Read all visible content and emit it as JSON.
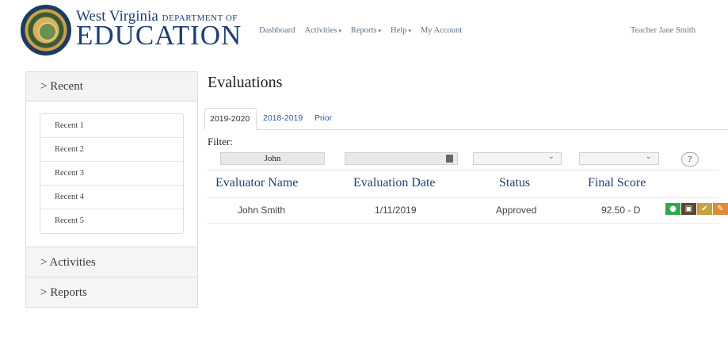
{
  "header": {
    "brand_top": "West Virginia",
    "brand_dept": "DEPARTMENT OF",
    "brand_main": "EDUCATION",
    "nav": [
      {
        "label": "Dashboard",
        "caret": false
      },
      {
        "label": "Activities",
        "caret": true
      },
      {
        "label": "Reports",
        "caret": true
      },
      {
        "label": "Help",
        "caret": true
      },
      {
        "label": "My Account",
        "caret": false
      }
    ],
    "caret_glyph": "▾",
    "user_name": "Teacher Jane Smith"
  },
  "sidebar": {
    "recent_header": "> Recent",
    "recent_items": [
      "Recent 1",
      "Recent 2",
      "Recent 3",
      "Recent 4",
      "Recent 5"
    ],
    "activities_header": "> Activities",
    "reports_header": "> Reports"
  },
  "main": {
    "title": "Evaluations",
    "tabs": [
      "2019-2020",
      "2018-2019",
      "Prior"
    ],
    "filter_label": "Filter:",
    "filter_name_value": "John",
    "help_label": "?",
    "columns": [
      "Evaluator Name",
      "Evaluation Date",
      "Status",
      "Final Score"
    ],
    "rows": [
      {
        "evaluator": "John Smith",
        "date": "1/11/2019",
        "status": "Approved",
        "score": "92.50 - D"
      }
    ]
  },
  "action_colors": {
    "view": "#2eaa4a",
    "print": "#5a4636",
    "approve": "#c9a33a",
    "edit": "#e08a3a"
  },
  "icons": {
    "view": "eye-icon",
    "print": "print-icon",
    "approve": "check-icon",
    "edit": "pencil-icon",
    "calendar": "calendar-icon",
    "chevron": "chevron-down-icon"
  }
}
